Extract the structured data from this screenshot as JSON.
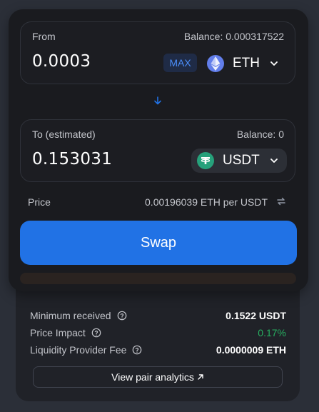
{
  "from": {
    "label": "From",
    "balance": "Balance: 0.000317522",
    "amount": "0.0003",
    "max_label": "MAX",
    "token": "ETH"
  },
  "to": {
    "label": "To (estimated)",
    "balance": "Balance: 0",
    "amount": "0.153031",
    "token": "USDT"
  },
  "price": {
    "label": "Price",
    "value": "0.00196039 ETH per USDT"
  },
  "swap_label": "Swap",
  "details": {
    "min_received_label": "Minimum received",
    "min_received_value": "0.1522 USDT",
    "price_impact_label": "Price Impact",
    "price_impact_value": "0.17%",
    "lp_fee_label": "Liquidity Provider Fee",
    "lp_fee_value": "0.0000009 ETH",
    "analytics_label": "View pair analytics"
  },
  "icons": {
    "eth": "ethereum-icon",
    "usdt": "tether-icon",
    "chevron": "chevron-down-icon",
    "arrow": "arrow-down-icon",
    "refresh": "refresh-icon",
    "help": "help-icon",
    "external": "external-link-icon"
  },
  "colors": {
    "accent": "#2172e5",
    "max_text": "#4b8df8",
    "positive": "#27ae60"
  }
}
